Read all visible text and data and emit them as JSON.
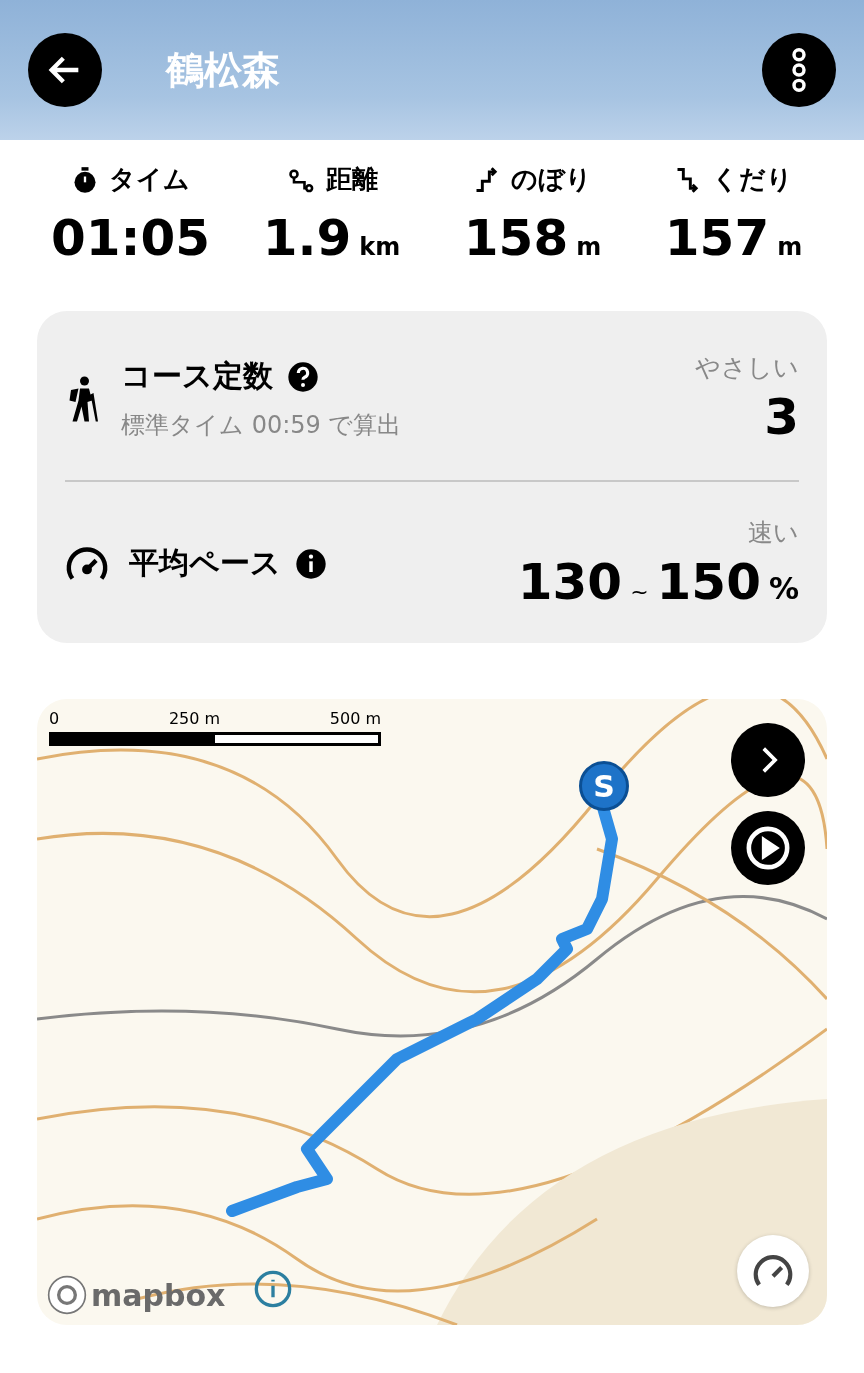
{
  "header": {
    "title": "鶴松森"
  },
  "stats": [
    {
      "kind": "time",
      "label": "タイム",
      "value": "01:05"
    },
    {
      "kind": "distance",
      "label": "距離",
      "value": "1.9",
      "unit": "km"
    },
    {
      "kind": "up",
      "label": "のぼり",
      "value": "158",
      "unit": "m"
    },
    {
      "kind": "down",
      "label": "くだり",
      "value": "157",
      "unit": "m"
    }
  ],
  "card": {
    "rows": [
      {
        "kind": "course",
        "title": "コース定数",
        "hint": {
          "kind": "help"
        },
        "subtitle": "標準タイム 00:59 で算出",
        "rating": "やさしい",
        "values": [
          "3"
        ]
      },
      {
        "kind": "pace",
        "title": "平均ペース",
        "hint": {
          "kind": "info"
        },
        "rating": "速い",
        "values": [
          "130",
          "150"
        ],
        "separator": "~",
        "unit": "%"
      }
    ]
  },
  "map": {
    "scale": [
      "0",
      "250 m",
      "500 m"
    ],
    "start_label": "S",
    "attribution": "mapbox"
  }
}
